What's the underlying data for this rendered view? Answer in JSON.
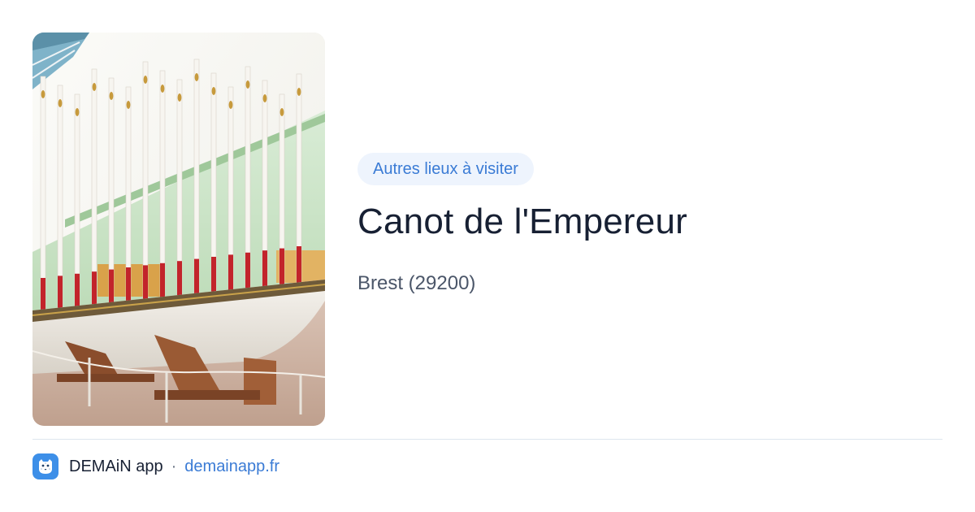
{
  "card": {
    "image_alt": "Canot de l'Empereur",
    "badge": "Autres lieux à visiter",
    "title": "Canot de l'Empereur",
    "subtitle": "Brest (29200)"
  },
  "footer": {
    "app_icon": "snow-leopard-logo-icon",
    "app_name": "DEMAiN app",
    "separator": "·",
    "domain": "demainapp.fr"
  },
  "colors": {
    "accent": "#3a7bd5",
    "badge_bg": "#eef4fd",
    "title": "#172033",
    "subtitle": "#4b5669",
    "divider": "#dde6ee",
    "app_icon_bg": "#3d8fe8"
  }
}
